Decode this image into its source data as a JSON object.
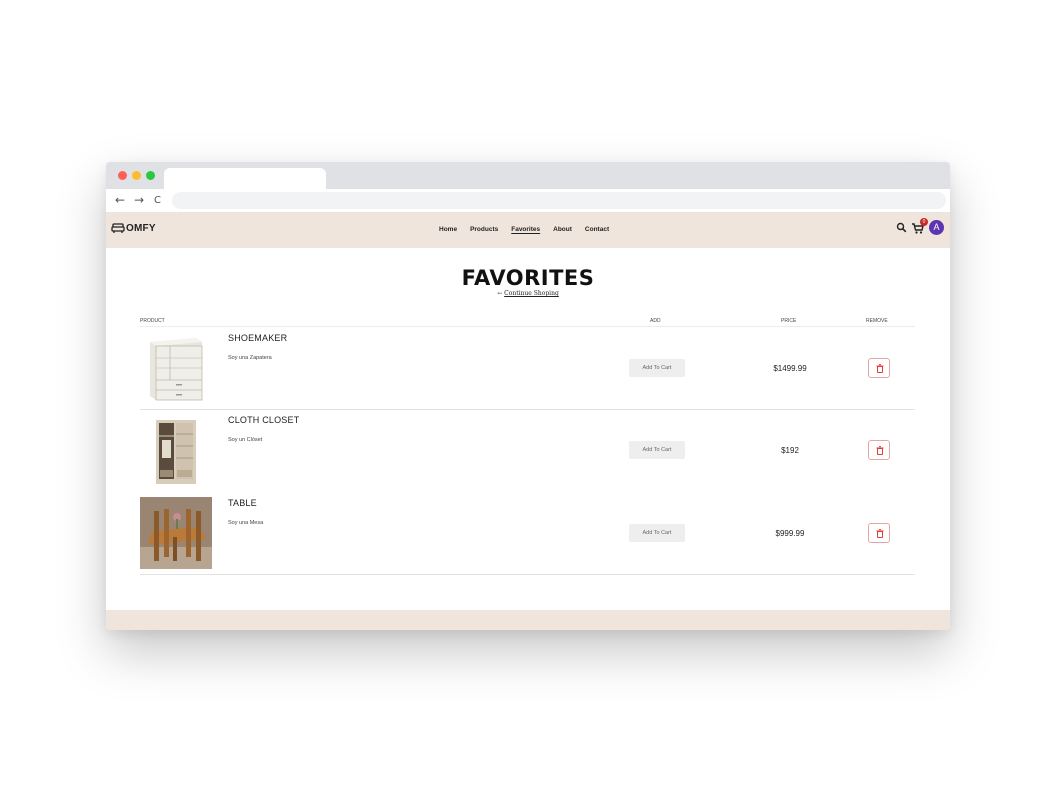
{
  "browser": {
    "back": "←",
    "forward": "→",
    "reload": "C",
    "colors": {
      "close": "#ff5f57",
      "minimize": "#febc2e",
      "maximize": "#28c840"
    }
  },
  "header": {
    "logo_text": "OMFY",
    "nav": [
      "Home",
      "Products",
      "Favorites",
      "About",
      "Contact"
    ],
    "active_nav": "Favorites",
    "cart_count": "0",
    "avatar_letter": "A",
    "colors": {
      "bg": "#efe5dc",
      "badge": "#c62828",
      "avatar": "#5e35b1"
    }
  },
  "page": {
    "title": "FAVORITES",
    "continue_arrow": "←",
    "continue_text": "Continue Shoping"
  },
  "table": {
    "headers": {
      "product": "PRODUCT",
      "add": "ADD",
      "price": "PRICE",
      "remove": "REMOVE"
    },
    "rows": [
      {
        "name": "SHOEMAKER",
        "desc": "Soy una Zapatera",
        "add_label": "Add To Cart",
        "price": "$1499.99",
        "image": "white-shoe-cabinet"
      },
      {
        "name": "CLOTH CLOSET",
        "desc": "Soy un Clóset",
        "add_label": "Add To Cart",
        "price": "$192",
        "image": "wooden-wardrobe"
      },
      {
        "name": "TABLE",
        "desc": "Soy una Mesa",
        "add_label": "Add To Cart",
        "price": "$999.99",
        "image": "dining-table-set"
      }
    ]
  }
}
